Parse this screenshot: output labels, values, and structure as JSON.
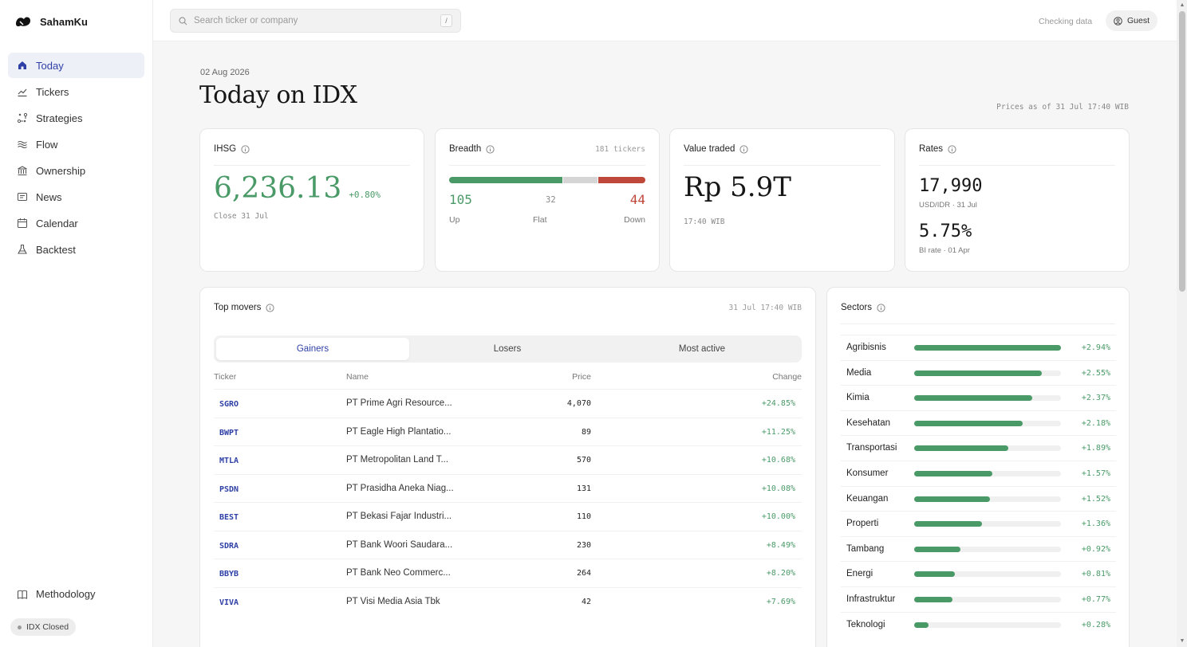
{
  "brand": {
    "name": "SahamKu"
  },
  "nav": [
    {
      "label": "Today",
      "icon": "home-icon",
      "active": true
    },
    {
      "label": "Tickers",
      "icon": "chart-line-icon"
    },
    {
      "label": "Strategies",
      "icon": "strategy-icon"
    },
    {
      "label": "Flow",
      "icon": "flow-icon"
    },
    {
      "label": "Ownership",
      "icon": "bank-icon"
    },
    {
      "label": "News",
      "icon": "newspaper-icon"
    },
    {
      "label": "Calendar",
      "icon": "calendar-icon"
    },
    {
      "label": "Backtest",
      "icon": "flask-icon"
    }
  ],
  "sidebar_footer": {
    "methodology": "Methodology",
    "market_status": "IDX Closed"
  },
  "topbar": {
    "search_placeholder": "Search ticker or company",
    "shortcut": "/",
    "status": "Checking data",
    "user": "Guest"
  },
  "header": {
    "date": "02 Aug 2026",
    "title": "Today on IDX",
    "as_of": "Prices as of 31 Jul 17:40 WIB"
  },
  "ihsg": {
    "label": "IHSG",
    "value": "6,236.13",
    "change": "+0.80%",
    "sub": "Close 31 Jul"
  },
  "breadth": {
    "label": "Breadth",
    "tickers": "181 tickers",
    "up": "105",
    "flat": "32",
    "down": "44",
    "up_label": "Up",
    "flat_label": "Flat",
    "down_label": "Down",
    "up_n": 105,
    "flat_n": 32,
    "down_n": 44
  },
  "value_traded": {
    "label": "Value traded",
    "value": "Rp 5.9T",
    "sub": "17:40 WIB"
  },
  "rates": {
    "label": "Rates",
    "fx": "17,990",
    "fx_sub": "USD/IDR · 31 Jul",
    "bi": "5.75%",
    "bi_sub": "BI rate · 01 Apr"
  },
  "movers": {
    "label": "Top movers",
    "timestamp": "31 Jul 17:40 WIB",
    "tabs": [
      "Gainers",
      "Losers",
      "Most active"
    ],
    "columns": [
      "Ticker",
      "Name",
      "Price",
      "Change"
    ],
    "rows": [
      {
        "ticker": "SGRO",
        "name": "PT Prime Agri Resource...",
        "price": "4,070",
        "change": "+24.85%"
      },
      {
        "ticker": "BWPT",
        "name": "PT Eagle High Plantatio...",
        "price": "89",
        "change": "+11.25%"
      },
      {
        "ticker": "MTLA",
        "name": "PT Metropolitan Land T...",
        "price": "570",
        "change": "+10.68%"
      },
      {
        "ticker": "PSDN",
        "name": "PT Prasidha Aneka Niag...",
        "price": "131",
        "change": "+10.08%"
      },
      {
        "ticker": "BEST",
        "name": "PT Bekasi Fajar Industri...",
        "price": "110",
        "change": "+10.00%"
      },
      {
        "ticker": "SDRA",
        "name": "PT Bank Woori Saudara...",
        "price": "230",
        "change": "+8.49%"
      },
      {
        "ticker": "BBYB",
        "name": "PT Bank Neo Commerc...",
        "price": "264",
        "change": "+8.20%"
      },
      {
        "ticker": "VIVA",
        "name": "PT Visi Media Asia Tbk",
        "price": "42",
        "change": "+7.69%"
      }
    ]
  },
  "sectors": {
    "label": "Sectors",
    "rows": [
      {
        "name": "Agribisnis",
        "change": "+2.94%",
        "pct": 2.94
      },
      {
        "name": "Media",
        "change": "+2.55%",
        "pct": 2.55
      },
      {
        "name": "Kimia",
        "change": "+2.37%",
        "pct": 2.37
      },
      {
        "name": "Kesehatan",
        "change": "+2.18%",
        "pct": 2.18
      },
      {
        "name": "Transportasi",
        "change": "+1.89%",
        "pct": 1.89
      },
      {
        "name": "Konsumer",
        "change": "+1.57%",
        "pct": 1.57
      },
      {
        "name": "Keuangan",
        "change": "+1.52%",
        "pct": 1.52
      },
      {
        "name": "Properti",
        "change": "+1.36%",
        "pct": 1.36
      },
      {
        "name": "Tambang",
        "change": "+0.92%",
        "pct": 0.92
      },
      {
        "name": "Energi",
        "change": "+0.81%",
        "pct": 0.81
      },
      {
        "name": "Infrastruktur",
        "change": "+0.77%",
        "pct": 0.77
      },
      {
        "name": "Teknologi",
        "change": "+0.28%",
        "pct": 0.28
      }
    ]
  },
  "colors": {
    "accent": "#2e3fa5",
    "up": "#4a9a68",
    "down": "#c0483a",
    "flat": "#d5d5d5"
  }
}
